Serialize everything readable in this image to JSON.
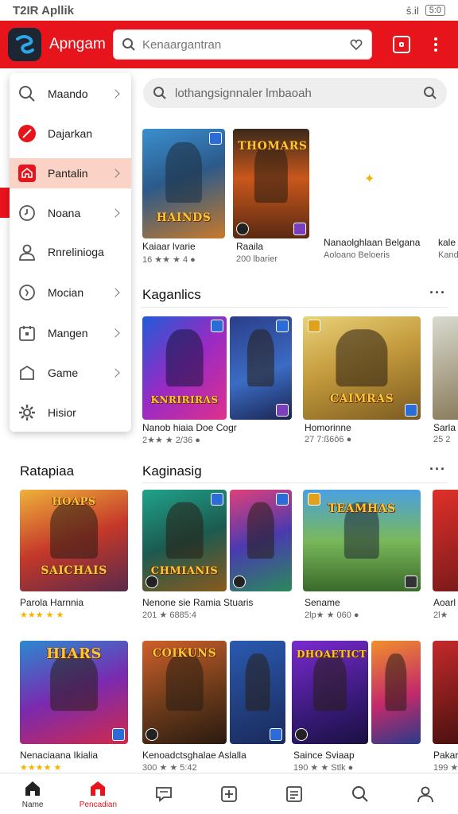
{
  "status_bar": {
    "time_app": "T2IR Apllik",
    "signal_text": "ṥ.il",
    "battery": "5:0"
  },
  "header": {
    "app_name": "Apngam",
    "search_placeholder": "Kenaargantran"
  },
  "main_search": {
    "placeholder": "lothangsignnaler lmbaoah"
  },
  "drawer": {
    "items": [
      {
        "label": "Maando",
        "icon": "search-icon",
        "has_chevron": true,
        "active": false
      },
      {
        "label": "Dajarkan",
        "icon": "red-circle-icon",
        "has_chevron": false,
        "active": false
      },
      {
        "label": "Pantalin",
        "icon": "home-icon",
        "has_chevron": true,
        "active": true
      },
      {
        "label": "Noana",
        "icon": "clock-icon",
        "has_chevron": true,
        "active": false
      },
      {
        "label": "Rnrelinioga",
        "icon": "user-icon",
        "has_chevron": false,
        "active": false
      },
      {
        "label": "Mocian",
        "icon": "circle-icon",
        "has_chevron": true,
        "active": false
      },
      {
        "label": "Mangen",
        "icon": "calendar-icon",
        "has_chevron": true,
        "active": false
      },
      {
        "label": "Game",
        "icon": "box-icon",
        "has_chevron": true,
        "active": false
      },
      {
        "label": "Hisior",
        "icon": "gear-icon",
        "has_chevron": false,
        "active": false
      }
    ]
  },
  "featured": {
    "cards": [
      {
        "art_title": "HAINDS",
        "title": "Kaiaar lvarie",
        "sub": "16 ★★ ★ 4 ●"
      },
      {
        "art_title": "THOMARS",
        "title": "Raaila",
        "sub": "200 lbarier"
      }
    ],
    "extra": [
      {
        "title": "Nanaolghlaan Belgana",
        "sub": "Aoloano Beloeris"
      },
      {
        "title": "kale",
        "sub": "Kand"
      }
    ]
  },
  "section_kaganlics": {
    "title": "Kaganlics",
    "cards": [
      {
        "art_title": "KNRIRIRAS",
        "title": "Nanob hiaia Doe Cogr",
        "sub": "2★★ ★ 2/36 ●"
      },
      {
        "art_title": "CAIMRAS",
        "title": "Homorinne",
        "sub": "27 7:ß6ô6 ●"
      },
      {
        "art_title": "",
        "title": "Sarla",
        "sub": "25 2"
      }
    ]
  },
  "section_ratapiaa": {
    "title": "Ratapiaa",
    "cards": [
      {
        "art_title": "SAICHAIS",
        "title": "Parola Harnnia",
        "sub": "★★★ ★ ★"
      }
    ]
  },
  "section_kaginasig": {
    "title": "Kaginasig",
    "cards": [
      {
        "art_title": "CHMIANIS",
        "title": "Nenone sie Ramia Stuaris",
        "sub": "201 ★ 6885:4"
      },
      {
        "art_title": "TEAMHAS",
        "title": "Sename",
        "sub": "2lp★ ★ 060 ●"
      },
      {
        "art_title": "",
        "title": "Aoarl",
        "sub": "2l★"
      }
    ]
  },
  "section_row4": {
    "cards": [
      {
        "art_title": "HIARS",
        "title": "Nenaciaana Ikialia",
        "sub": "★★★★ ★"
      },
      {
        "art_title": "COIKUNS",
        "title": "Kenoadctsghalae Aslalla",
        "sub": "300 ★ ★ 5:42"
      },
      {
        "art_title": "DHOAETICT",
        "title": "Saince Sviaap",
        "sub": "190 ★ ★ Stlk ●"
      },
      {
        "art_title": "",
        "title": "Pakar",
        "sub": "199 ★"
      }
    ]
  },
  "bottom_nav": {
    "items": [
      {
        "label": "Name",
        "icon": "home-icon",
        "active": false
      },
      {
        "label": "Pencadian",
        "icon": "store-icon",
        "active": true
      },
      {
        "label": "",
        "icon": "chat-icon",
        "active": false
      },
      {
        "label": "",
        "icon": "plus-icon",
        "active": false
      },
      {
        "label": "",
        "icon": "list-icon",
        "active": false
      },
      {
        "label": "",
        "icon": "search-icon",
        "active": false
      },
      {
        "label": "",
        "icon": "profile-icon",
        "active": false
      }
    ]
  },
  "colors": {
    "brand_red": "#e8141c",
    "star": "#f5b300"
  }
}
